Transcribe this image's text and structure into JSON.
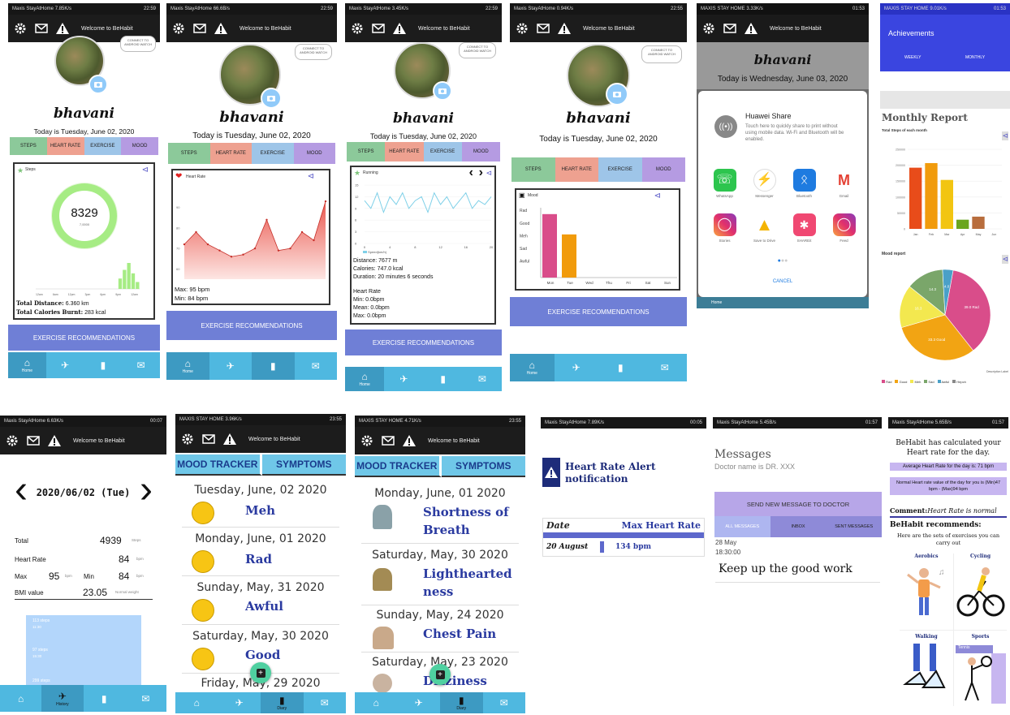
{
  "status": {
    "p1": {
      "carrier": "Maxis StayAtHome",
      "speed": "7.85K/s",
      "time": "22:59"
    },
    "p2": {
      "carrier": "Maxis StayAtHome",
      "speed": "66.6B/s",
      "time": "22:59"
    },
    "p3": {
      "carrier": "Maxis StayAtHome",
      "speed": "3.45K/s",
      "time": "22:59"
    },
    "p4": {
      "carrier": "Maxis StayAtHome",
      "speed": "0.94K/s",
      "time": "22:55"
    },
    "p5": {
      "carrier": "MAXIS STAY HOME",
      "speed": "3.33K/s",
      "time": "01:53"
    },
    "p6": {
      "carrier": "MAXIS STAY HOME",
      "speed": "9.01K/s",
      "time": "01:53"
    },
    "p7": {
      "carrier": "Maxis StayAtHome",
      "speed": "6.63K/s",
      "time": "00:07"
    },
    "p8": {
      "carrier": "MAXIS STAY HOME",
      "speed": "3.96K/s",
      "time": "23:55"
    },
    "p9": {
      "carrier": "MAXIS STAY HOME",
      "speed": "4.71K/s",
      "time": "23:55"
    },
    "p10": {
      "carrier": "Maxis StayAtHome",
      "speed": "7.89K/s",
      "time": "00:05"
    },
    "p11": {
      "carrier": "Maxis StayAtHome",
      "speed": "5.45B/s",
      "time": "01:57"
    },
    "p12": {
      "carrier": "Maxis StayAtHome",
      "speed": "5.65B/s",
      "time": "01:57"
    }
  },
  "appbar_title": "Welcome to BeHabit",
  "profile_bubble": "CONNECT TO ANDROID WATCH",
  "user_name": "bhavani",
  "today_june02": "Today is Tuesday, June 02, 2020",
  "today_june03": "Today is Wednesday, June 03, 2020",
  "tabs": {
    "steps": "STEPS",
    "heart": "HEART RATE",
    "exercise": "EXERCISE",
    "mood": "MOOD"
  },
  "exercise_btn": "EXERCISE RECOMMENDATIONS",
  "nav": {
    "home": "Home",
    "history": "History",
    "diary": "Diary"
  },
  "steps_card": {
    "title": "Steps",
    "count": "8329",
    "goal": "7,0000",
    "hours": [
      "12am",
      "3am",
      "6am",
      "9am",
      "12pm",
      "3pm",
      "6pm",
      "9pm",
      "12am"
    ],
    "distance_label": "Total Distance:",
    "distance_value": "6.360 km",
    "calories_label": "Total Calories Burnt:",
    "calories_value": "283 kcal"
  },
  "heart_card": {
    "title": "Heart Rate",
    "max": "Max: 95 bpm",
    "min": "Min: 84 bpm",
    "yticks": [
      "90",
      "80",
      "70",
      "60"
    ]
  },
  "exercise_card": {
    "title": "Running",
    "yticks": [
      "15",
      "12",
      "9",
      "6",
      "3",
      "0"
    ],
    "xticks": [
      "0",
      "4",
      "8",
      "12",
      "16",
      "20"
    ],
    "legend": "Speed(km/h)",
    "distance": "Distance: 7677 m",
    "calories": "Calories: 747.0 kcal",
    "duration": "Duration: 20 minutes 6 seconds",
    "hr_title": "Heart Rate",
    "hr_min": "Min: 0.0bpm",
    "hr_mean": "Mean: 0.0bpm",
    "hr_max": "Max: 0.0bpm"
  },
  "mood_card": {
    "title": "Mood",
    "ylabels": [
      "Rad",
      "Good",
      "Meh",
      "Sad",
      "Awful"
    ],
    "days": [
      "Mon",
      "Tue",
      "Wed",
      "Thu",
      "Fri",
      "Sat",
      "Sun"
    ]
  },
  "share": {
    "title": "Huawei Share",
    "desc": "Touch here to quickly share to print without using mobile data. Wi-Fi and Bluetooth will be enabled.",
    "apps": [
      "WhatsApp",
      "Messenger",
      "Bluetooth",
      "Gmail",
      "Stories",
      "Save to Drive",
      "SHAREit",
      "Feed"
    ],
    "cancel": "CANCEL",
    "nav_home": "Home"
  },
  "achievements": {
    "title": "Achievements",
    "weekly": "WEEKLY",
    "monthly": "MONTHLY",
    "monthly_report": "Monthly Report",
    "steps_subtitle": "Total Steps of each month",
    "mood_report": "Mood report",
    "legend": [
      "Rad",
      "Good",
      "Meh",
      "Sad",
      "Awful",
      "Hepch"
    ],
    "pie_labels": [
      "39.0 Rad",
      "33.3 Good",
      "16.3",
      "14.3",
      "4.0"
    ],
    "pie_note": "Description Label"
  },
  "history": {
    "date": "2020/06/02 (Tue)",
    "total_label": "Total",
    "total_value": "4939",
    "total_unit": "Steps",
    "hr_label": "Heart Rate",
    "hr_value": "84",
    "hr_unit": "bpm",
    "max_label": "Max",
    "max_value": "95",
    "min_label": "Min",
    "min_value": "84",
    "bpm": "bpm",
    "bmi_label": "BMI value",
    "bmi_value": "23.05",
    "bmi_unit": "Normal weight",
    "bars": [
      "113 steps",
      "97 steps",
      "299 steps"
    ],
    "bar_times": [
      "11:30",
      "15:30",
      ""
    ]
  },
  "mood_tracker": {
    "tab1": "MOOD TRACKER",
    "tab2": "SYMPTOMS",
    "entries": [
      {
        "date": "Tuesday, June, 02 2020",
        "mood": "Meh"
      },
      {
        "date": "Monday, June, 01 2020",
        "mood": "Rad"
      },
      {
        "date": "Sunday, May, 31 2020",
        "mood": "Awful"
      },
      {
        "date": "Saturday, May, 30 2020",
        "mood": "Good"
      },
      {
        "date": "Friday, May, 29 2020",
        "mood": ""
      }
    ]
  },
  "symptoms": {
    "entries": [
      {
        "date": "Monday, June, 01 2020",
        "symptom": "Shortness of",
        "symptom2": "Breath"
      },
      {
        "date": "Saturday, May, 30 2020",
        "symptom": "Lighthearted",
        "symptom2": "ness"
      },
      {
        "date": "Sunday, May, 24 2020",
        "symptom": "Chest Pain",
        "symptom2": ""
      },
      {
        "date": "Saturday, May, 23 2020",
        "symptom": "Dizziness",
        "symptom2": ""
      }
    ]
  },
  "alert": {
    "title": "Heart Rate Alert notification",
    "col_date": "Date",
    "col_max": "Max Heart Rate",
    "row_date": "20 August",
    "row_value": "134 bpm"
  },
  "messages": {
    "title": "Messages",
    "doctor": "Doctor name is DR. XXX",
    "send": "SEND NEW MESSAGE TO DOCTOR",
    "tabs": [
      "ALL MESSAGES",
      "INBOX",
      "SENT MESSAGES"
    ],
    "msg_date": "28 May",
    "msg_time": "18:30:00",
    "msg_text": "Keep up the good work"
  },
  "recommend": {
    "headline": "BeHabit has calculated your Heart rate for the day.",
    "avg": "Average Heart Rate for the day is: 71 bpm",
    "normal": "Normal Heart rate value of the day for you is (Min)47 bpm - (Max)94 bpm",
    "comment_label": "Comment:",
    "comment_value": "Heart Rate is normal",
    "rec_title": "BeHabit recommends:",
    "rec_sub": "Here are the sets of exercises you can carry out",
    "items": [
      "Aerobics",
      "Cycling",
      "Walking",
      "Sports"
    ],
    "sports_sub": "Tennis"
  },
  "chart_data": [
    {
      "type": "bar",
      "title": "Monthly Report",
      "subtitle": "Total Steps of each month",
      "categories": [
        "Jan",
        "Feb",
        "Mar",
        "Apr",
        "May",
        "Jun"
      ],
      "values": [
        200000,
        215000,
        160000,
        30000,
        40000,
        0
      ],
      "yticks": [
        "250000",
        "200000",
        "150000",
        "100000",
        "50000",
        "0"
      ],
      "ylim": [
        0,
        260000
      ],
      "colors": [
        "#e84c1a",
        "#f19b0c",
        "#f2c511",
        "#6aa51f",
        "#b86d3d",
        "#999999"
      ]
    },
    {
      "type": "pie",
      "title": "Mood report",
      "categories": [
        "Rad",
        "Good",
        "Meh",
        "Sad",
        "Awful"
      ],
      "values": [
        39.0,
        33.3,
        16.3,
        14.3,
        4.0
      ],
      "colors": [
        "#d94d8a",
        "#f2a413",
        "#f3e84f",
        "#7aa66a",
        "#4aa0c8"
      ]
    },
    {
      "type": "bar",
      "title": "Mood",
      "categories": [
        "Mon",
        "Tue",
        "Wed",
        "Thu",
        "Fri",
        "Sat",
        "Sun"
      ],
      "values": [
        5,
        3.4,
        0,
        0,
        0,
        0,
        0
      ],
      "colors": [
        "#d94d8a",
        "#f19b0c"
      ],
      "ylim": [
        0,
        5.5
      ]
    },
    {
      "type": "area",
      "title": "Heart Rate",
      "x": [
        0,
        1,
        2,
        3,
        4,
        5,
        6,
        7,
        8,
        9,
        10,
        11,
        12
      ],
      "values": [
        72,
        78,
        72,
        69,
        66,
        67,
        70,
        84,
        69,
        70,
        78,
        74,
        93
      ],
      "ylim": [
        55,
        97
      ]
    },
    {
      "type": "line",
      "title": "Running",
      "legend": "Speed(km/h)",
      "x": [
        0,
        1,
        2,
        3,
        4,
        5,
        6,
        7,
        8,
        9,
        10,
        11,
        12,
        13,
        14,
        15,
        16,
        17,
        18,
        19,
        20
      ],
      "values": [
        11,
        9,
        13,
        8,
        12,
        10,
        13,
        9,
        11,
        12,
        8,
        13,
        10,
        12,
        9,
        11,
        13,
        9,
        11,
        10,
        12
      ],
      "ylim": [
        0,
        15
      ]
    },
    {
      "type": "bar",
      "title": "Steps",
      "categories": [
        "12am",
        "3am",
        "6am",
        "9am",
        "12pm",
        "3pm",
        "6pm",
        "9pm",
        "12am"
      ],
      "values": [
        0,
        0,
        0,
        0,
        0,
        0,
        0,
        14,
        0
      ],
      "hourly": [
        0,
        0,
        0,
        0,
        0,
        0,
        0,
        0,
        0,
        0,
        0,
        0,
        0,
        0,
        0,
        0,
        0,
        0,
        0,
        12,
        22,
        30,
        18,
        8
      ]
    }
  ]
}
